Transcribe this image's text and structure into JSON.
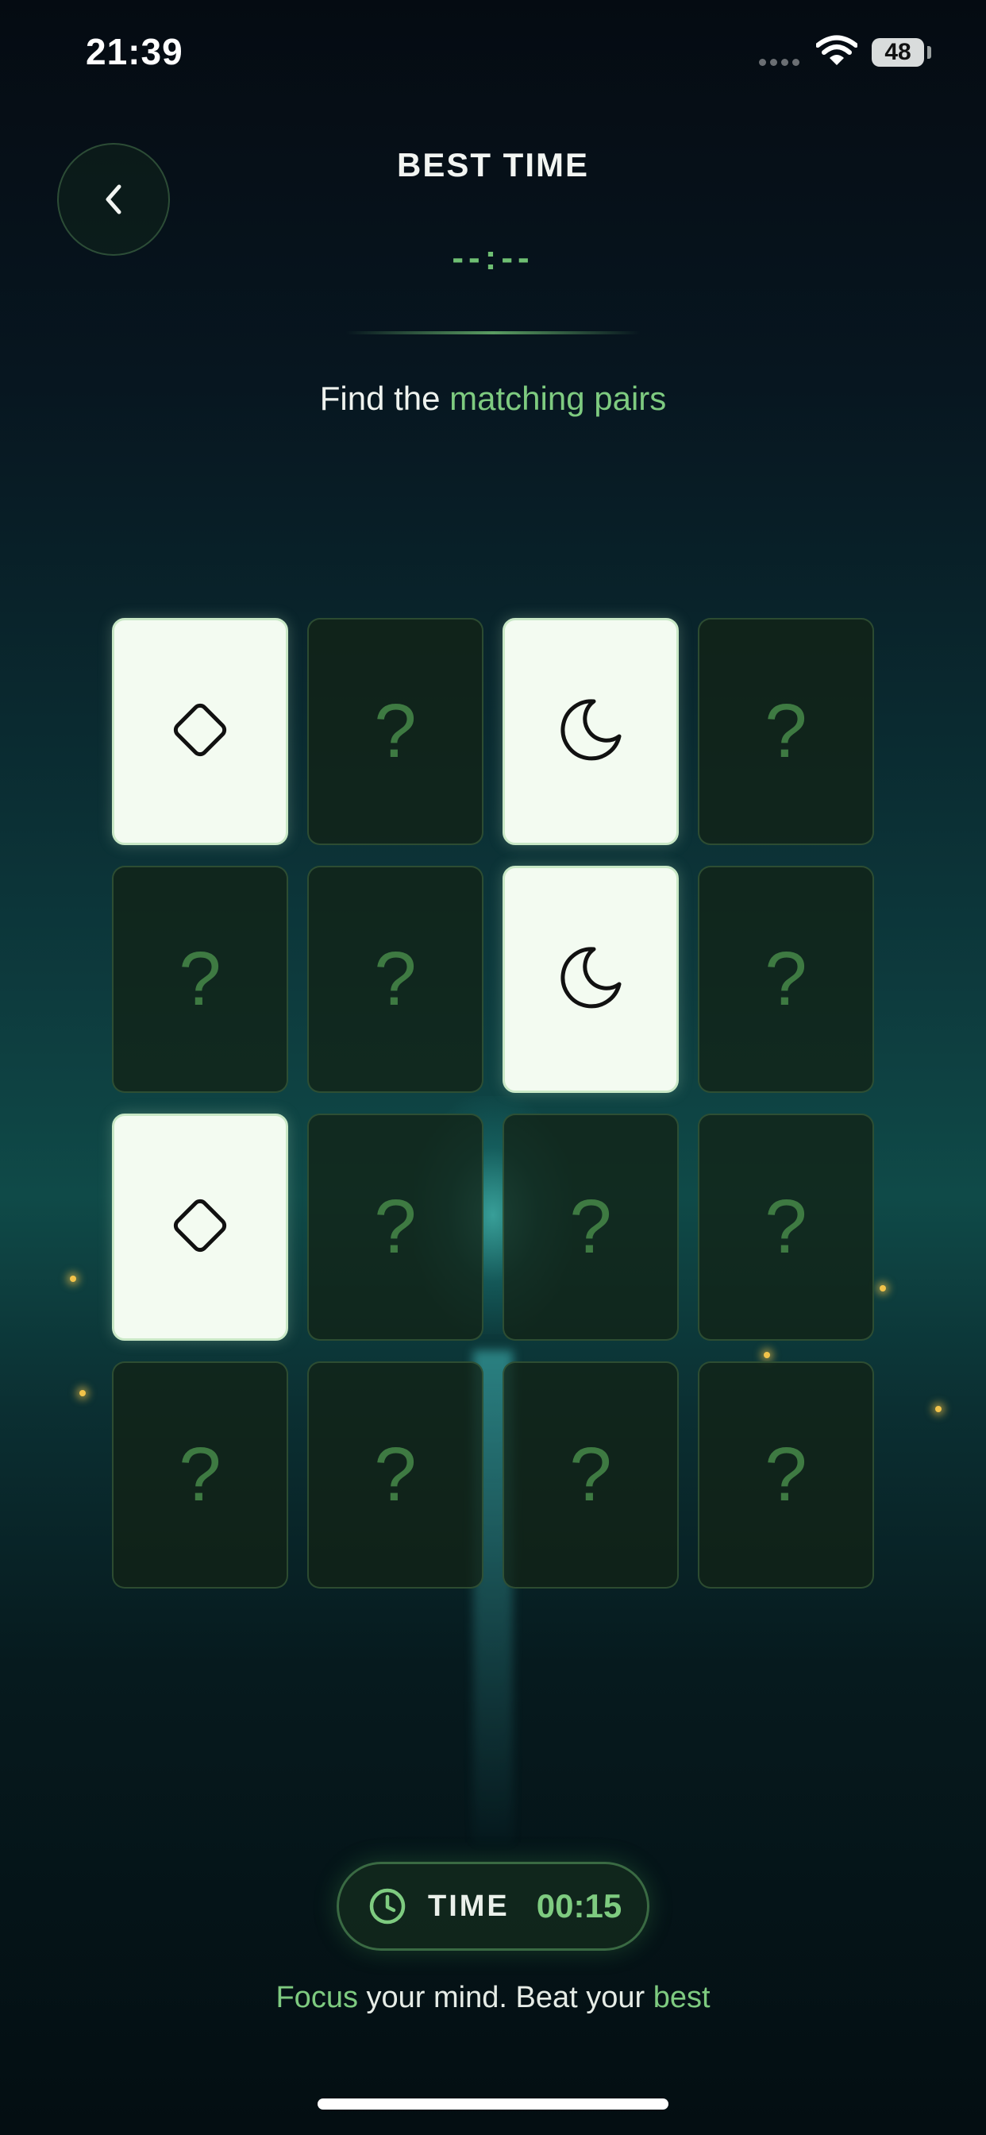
{
  "status_bar": {
    "time": "21:39",
    "battery": "48"
  },
  "header": {
    "back_icon": "chevron-left-icon",
    "best_time_label": "BEST TIME",
    "best_time_value": "--:--"
  },
  "instruction": {
    "prefix": "Find the ",
    "highlight": "matching pairs"
  },
  "board": {
    "rows": 4,
    "cols": 4,
    "hidden_symbol": "?",
    "cards": [
      {
        "state": "faceup",
        "icon": "diamond-icon"
      },
      {
        "state": "facedown",
        "icon": "question-mark"
      },
      {
        "state": "faceup",
        "icon": "moon-icon"
      },
      {
        "state": "facedown",
        "icon": "question-mark"
      },
      {
        "state": "facedown",
        "icon": "question-mark"
      },
      {
        "state": "facedown",
        "icon": "question-mark"
      },
      {
        "state": "faceup",
        "icon": "moon-icon"
      },
      {
        "state": "facedown",
        "icon": "question-mark"
      },
      {
        "state": "faceup",
        "icon": "diamond-icon"
      },
      {
        "state": "facedown",
        "icon": "question-mark"
      },
      {
        "state": "facedown",
        "icon": "question-mark"
      },
      {
        "state": "facedown",
        "icon": "question-mark"
      },
      {
        "state": "facedown",
        "icon": "question-mark"
      },
      {
        "state": "facedown",
        "icon": "question-mark"
      },
      {
        "state": "facedown",
        "icon": "question-mark"
      },
      {
        "state": "facedown",
        "icon": "question-mark"
      }
    ]
  },
  "timer": {
    "icon": "clock-icon",
    "label": "TIME",
    "value": "00:15"
  },
  "tagline": {
    "w1": "Focus",
    "t1": " your mind. Beat your ",
    "w2": "best"
  },
  "colors": {
    "accent": "#7ecb80",
    "card_face": "#f3fbf1",
    "card_back": "#122216"
  }
}
